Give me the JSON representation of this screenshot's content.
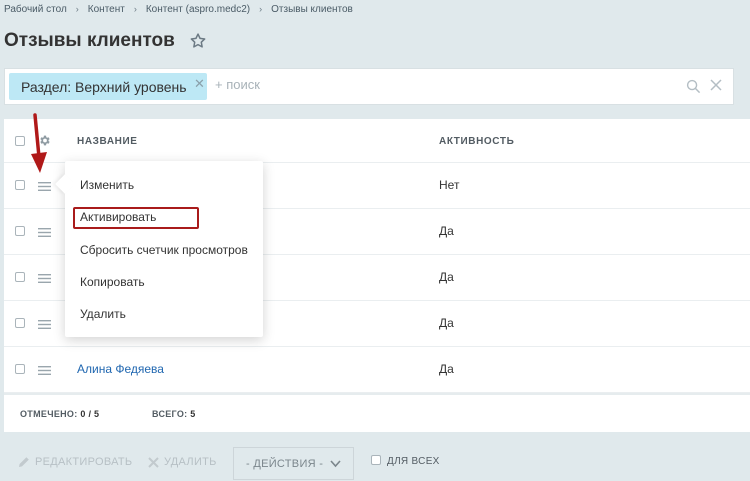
{
  "breadcrumb": [
    "Рабочий стол",
    "Контент",
    "Контент (aspro.medc2)",
    "Отзывы клиентов"
  ],
  "page": {
    "title": "Отзывы клиентов"
  },
  "filter": {
    "chip": "Раздел: Верхний уровень",
    "placeholder": "+ поиск"
  },
  "grid": {
    "columns": {
      "name": "НАЗВАНИЕ",
      "active": "АКТИВНОСТЬ"
    },
    "rows": [
      {
        "name": "",
        "active": "Нет"
      },
      {
        "name": "",
        "active": "Да"
      },
      {
        "name": "",
        "active": "Да"
      },
      {
        "name": "",
        "active": "Да"
      },
      {
        "name": "Алина Федяева",
        "active": "Да"
      }
    ],
    "footer": {
      "selected_label": "ОТМЕЧЕНО:",
      "selected_value": "0 / 5",
      "total_label": "ВСЕГО:",
      "total_value": "5"
    }
  },
  "context_menu": {
    "items": [
      "Изменить",
      "Активировать",
      "Сбросить счетчик просмотров",
      "Копировать",
      "Удалить"
    ]
  },
  "actions": {
    "edit": "РЕДАКТИРОВАТЬ",
    "delete": "УДАЛИТЬ",
    "select": "- ДЕЙСТВИЯ -",
    "for_all": "ДЛЯ ВСЕХ"
  },
  "colors": {
    "accent_link": "#2067b0",
    "chip": "#bde8f5",
    "highlight": "#a91b1b",
    "background": "#e0e9ec"
  },
  "icons": {
    "favorite": "star-icon",
    "settings": "gear-icon",
    "row_menu": "hamburger-icon",
    "search": "search-icon",
    "clear": "close-icon"
  }
}
